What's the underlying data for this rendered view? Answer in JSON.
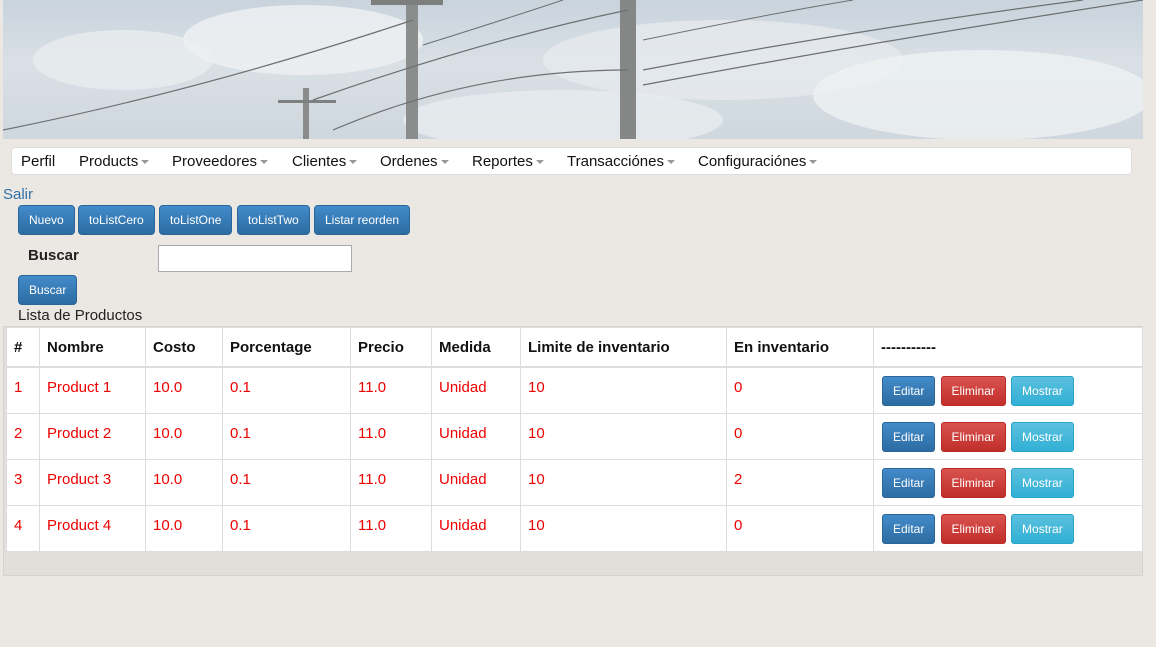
{
  "nav": {
    "items": [
      {
        "label": "Perfil",
        "dropdown": false
      },
      {
        "label": "Products",
        "dropdown": true
      },
      {
        "label": "Proveedores",
        "dropdown": true
      },
      {
        "label": "Clientes",
        "dropdown": true
      },
      {
        "label": "Ordenes",
        "dropdown": true
      },
      {
        "label": "Reportes",
        "dropdown": true
      },
      {
        "label": "Transacciónes",
        "dropdown": true
      },
      {
        "label": "Configuraciónes",
        "dropdown": true
      }
    ]
  },
  "salir": "Salir",
  "toolbar": {
    "nuevo": "Nuevo",
    "to_list_cero": "toListCero",
    "to_list_one": "toListOne",
    "to_list_two": "toListTwo",
    "listar_reorden": "Listar reorden"
  },
  "search": {
    "label": "Buscar",
    "value": "",
    "button": "Buscar"
  },
  "list_title": "Lista de Productos",
  "table": {
    "headers": [
      "#",
      "Nombre",
      "Costo",
      "Porcentage",
      "Precio",
      "Medida",
      "Limite de inventario",
      "En inventario",
      "-----------"
    ],
    "rows": [
      [
        "1",
        "Product 1",
        "10.0",
        "0.1",
        "11.0",
        "Unidad",
        "10",
        "0"
      ],
      [
        "2",
        "Product 2",
        "10.0",
        "0.1",
        "11.0",
        "Unidad",
        "10",
        "0"
      ],
      [
        "3",
        "Product 3",
        "10.0",
        "0.1",
        "11.0",
        "Unidad",
        "10",
        "2"
      ],
      [
        "4",
        "Product 4",
        "10.0",
        "0.1",
        "11.0",
        "Unidad",
        "10",
        "0"
      ]
    ],
    "actions": {
      "edit": "Editar",
      "delete": "Eliminar",
      "show": "Mostrar"
    }
  },
  "colors": {
    "primary": "#3071a9",
    "danger": "#d9534f",
    "info": "#5bc0de",
    "row_text": "#ee0000"
  }
}
